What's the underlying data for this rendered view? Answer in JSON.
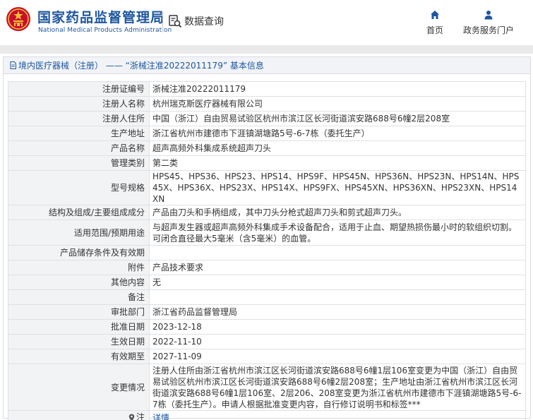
{
  "header": {
    "site_name_cn": "国家药品监督管理局",
    "site_name_en": "National Medical Products Administration",
    "search_label": "数据查询",
    "nav": {
      "home": "首页",
      "gov": "政务服务门户"
    }
  },
  "panel": {
    "breadcrumb": "境内医疗器械（注册） ——  “浙械注准20222011179” 基本信息"
  },
  "rows": [
    {
      "label": "注册证编号",
      "value": "浙械注准20222011179"
    },
    {
      "label": "注册人名称",
      "value": "杭州瑞克斯医疗器械有限公司"
    },
    {
      "label": "注册人住所",
      "value": "中国（浙江）自由贸易试验区杭州市滨江区长河街道滨安路688号6幢2层208室"
    },
    {
      "label": "生产地址",
      "value": "浙江省杭州市建德市下涯镇湖塘路5号-6-7栋（委托生产）"
    },
    {
      "label": "产品名称",
      "value": "超声高频外科集成系统超声刀头"
    },
    {
      "label": "管理类别",
      "value": "第二类"
    },
    {
      "label": "型号规格",
      "value": "HPS45、HPS36、HPS23、HPS14、HPS9F、HPS45N、HPS36N、HPS23N、HPS14N、HPS45X、HPS36X、HPS23X、HPS14X、HPS9FX、HPS45XN、HPS36XN、HPS23XN、HPS14XN"
    },
    {
      "label": "结构及组成/主要组成成分",
      "value": "产品由刀头和手柄组成，其中刀头分枪式超声刀头和剪式超声刀头。"
    },
    {
      "label": "适用范围/预期用途",
      "value": "与超声发生器或超声高频外科集成手术设备配合，适用于止血、期望热损伤最小时的软组织切割。可闭合直径最大5毫米（含5毫米）的血管。"
    },
    {
      "label": "产品储存条件及有效期",
      "value": ""
    },
    {
      "label": "附件",
      "value": "产品技术要求"
    },
    {
      "label": "其他内容",
      "value": "无"
    },
    {
      "label": "备注",
      "value": ""
    },
    {
      "label": "审批部门",
      "value": "浙江省药品监督管理局"
    },
    {
      "label": "批准日期",
      "value": "2023-12-18"
    },
    {
      "label": "生效日期",
      "value": "2022-11-10"
    },
    {
      "label": "有效期至",
      "value": "2027-11-09"
    },
    {
      "label": "变更情况",
      "value": "注册人住所由浙江省杭州市滨江区长河街道滨安路688号6幢1层106室变更为中国（浙江）自由贸易试验区杭州市滨江区长河街道滨安路688号6幢2层208室；生产地址由浙江省杭州市滨江区长河街道滨安路688号6幢1层106室、2层206、208室变更为浙江省杭州市建德市下涯镇湖塘路5号-6-7栋（委托生产）。申请人根据批准变更内容，自行修订说明书和标签***"
    }
  ],
  "note_row": {
    "label": "注",
    "value": "详情"
  },
  "colors": {
    "brand_blue": "#1e56a0",
    "label_bg": "#f2f3f5",
    "border": "#dde1e5"
  }
}
